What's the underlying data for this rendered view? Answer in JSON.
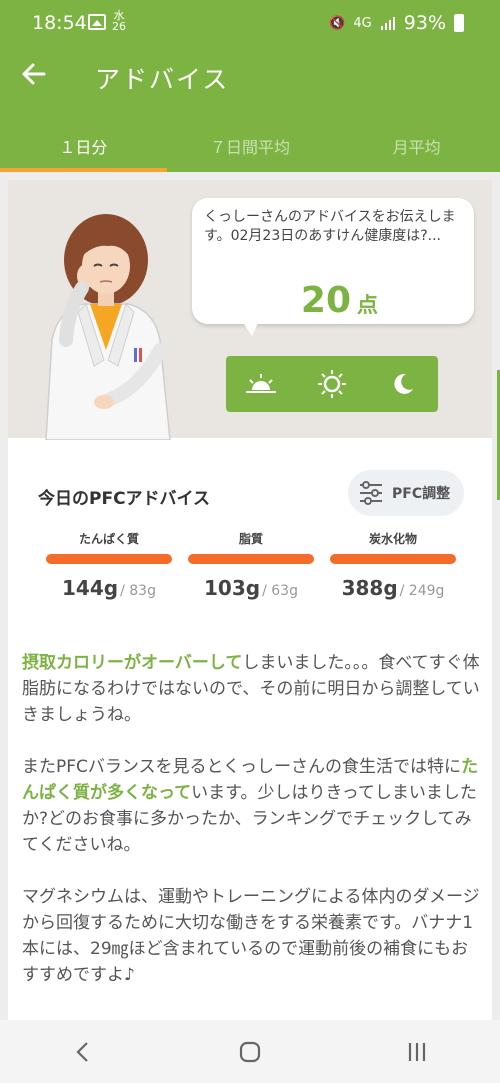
{
  "status_bar": {
    "time": "18:54",
    "weather": "水",
    "weather_temp": "26",
    "network": "4G",
    "battery": "93%"
  },
  "app_bar": {
    "back_icon": "arrow-left-icon",
    "title": "アドバイス"
  },
  "tabs": [
    {
      "label": "１日分",
      "active": true
    },
    {
      "label": "７日間平均",
      "active": false
    },
    {
      "label": "月平均",
      "active": false
    }
  ],
  "advisor": {
    "message": "くっしーさんのアドバイスをお伝えします。02月23日のあすけん健康度は?...",
    "score": "20",
    "score_unit": "点"
  },
  "time_buttons": [
    {
      "icon": "sunrise-icon"
    },
    {
      "icon": "sun-icon"
    },
    {
      "icon": "moon-icon"
    }
  ],
  "pfc": {
    "title": "今日のPFCアドバイス",
    "adjust_label": "PFC調整",
    "items": [
      {
        "label": "たんぱく質",
        "value": "144",
        "unit": "g",
        "target": "/ 83g",
        "fill": 1.0
      },
      {
        "label": "脂質",
        "value": "103",
        "unit": "g",
        "target": "/ 63g",
        "fill": 1.0
      },
      {
        "label": "炭水化物",
        "value": "388",
        "unit": "g",
        "target": "/ 249g",
        "fill": 1.0
      }
    ]
  },
  "advice": {
    "p1_highlight": "摂取カロリーがオーバーして",
    "p1_rest": "しまいました。。。食べてすぐ体脂肪になるわけではないので、その前に明日から調整していきましょうね。",
    "p2_start": "またPFCバランスを見るとくっしーさんの食生活では特に",
    "p2_highlight": "たんぱく質が多くなって",
    "p2_rest": "います。少しはりきってしまいましたか?どのお食事に多かったか、ランキングでチェックしてみてくださいね。",
    "p3": "マグネシウムは、運動やトレーニングによる体内のダメージから回復するために大切な働きをする栄養素です。バナナ1本には、29㎎ほど含まれているので運動前後の補食にもおすすめですよ♪"
  },
  "colors": {
    "brand_green": "#7cb342",
    "tab_indicator": "#f4a435",
    "bar_over": "#f56b2a"
  },
  "nav": [
    {
      "icon": "back-nav-icon"
    },
    {
      "icon": "home-nav-icon"
    },
    {
      "icon": "recents-nav-icon"
    }
  ]
}
